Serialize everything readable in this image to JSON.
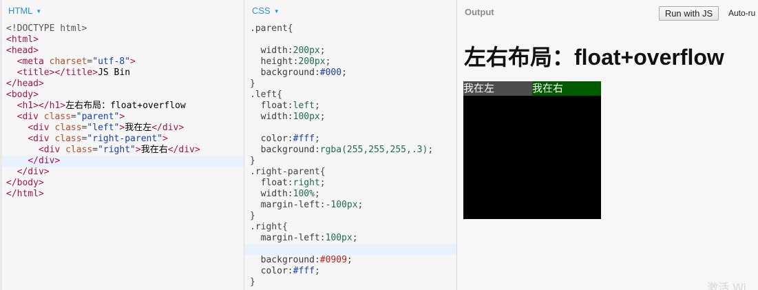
{
  "html_pane": {
    "label": "HTML",
    "code": [
      {
        "doctype": "<!DOCTYPE html>"
      },
      {
        "t1": "<html>"
      },
      {
        "t1": "<head>"
      },
      {
        "ind": "  ",
        "t1": "<meta ",
        "a1": "charset",
        "eq": "=",
        "s1": "\"utf-8\"",
        "t2": ">"
      },
      {
        "ind": "  ",
        "t1": "<title>",
        "x": "JS Bin",
        "t2": "</title>"
      },
      {
        "t1": "</head>"
      },
      {
        "t1": "<body>"
      },
      {
        "ind": "  ",
        "t1": "<h1>",
        "x": "左右布局：float+overflow",
        "t2": "</h1>"
      },
      {
        "ind": "  ",
        "t1": "<div ",
        "a1": "class",
        "eq": "=",
        "s1": "\"parent\"",
        "t2": ">"
      },
      {
        "ind": "    ",
        "t1": "<div ",
        "a1": "class",
        "eq": "=",
        "s1": "\"left\"",
        "t2": ">",
        "x": "我在左",
        "t3": "</div>"
      },
      {
        "ind": "    ",
        "t1": "<div ",
        "a1": "class",
        "eq": "=",
        "s1": "\"right-parent\"",
        "t2": ">"
      },
      {
        "ind": "      ",
        "t1": "<div ",
        "a1": "class",
        "eq": "=",
        "s1": "\"right\"",
        "t2": ">",
        "x": "我在右",
        "t3": "</div>"
      },
      {
        "ind": "    ",
        "t1": "</div>"
      },
      {
        "ind": "  ",
        "t1": "</div>"
      },
      {
        "t1": "</body>"
      },
      {
        "t1": "</html>"
      }
    ]
  },
  "css_pane": {
    "label": "CSS",
    "code": [
      {
        "sel": ".parent{"
      },
      {
        "blank": ""
      },
      {
        "ind": "  ",
        "prop": "width",
        "val": "200px",
        "end": ";"
      },
      {
        "ind": "  ",
        "prop": "height",
        "val": "200px",
        "end": ";"
      },
      {
        "ind": "  ",
        "prop": "background",
        "hex": "#000",
        "end": ";"
      },
      {
        "sel": "}"
      },
      {
        "sel": ".left{"
      },
      {
        "ind": "  ",
        "prop": "float",
        "val": "left",
        "end": ";"
      },
      {
        "ind": "  ",
        "prop": "width",
        "val": "100px",
        "end": ";"
      },
      {
        "blank": ""
      },
      {
        "ind": "  ",
        "prop": "color",
        "hex": "#fff",
        "end": ";"
      },
      {
        "ind": "  ",
        "prop": "background",
        "val": "rgba(255,255,255,.3)",
        "end": ";"
      },
      {
        "sel": "}"
      },
      {
        "sel": ".right-parent{"
      },
      {
        "ind": "  ",
        "prop": "float",
        "val": "right",
        "end": ";"
      },
      {
        "ind": "  ",
        "prop": "width",
        "val": "100%",
        "end": ";"
      },
      {
        "ind": "  ",
        "prop": "margin-left",
        "val": "-100px",
        "end": ";"
      },
      {
        "sel": "}"
      },
      {
        "sel": ".right{"
      },
      {
        "ind": "  ",
        "prop": "margin-left",
        "val": "100px",
        "end": ";"
      },
      {
        "blank": ""
      },
      {
        "ind": "  ",
        "prop": "background",
        "red": "#0909",
        "end": ";"
      },
      {
        "ind": "  ",
        "prop": "color",
        "hex": "#fff",
        "end": ";"
      },
      {
        "sel": "}"
      }
    ]
  },
  "output_pane": {
    "label": "Output",
    "run_button": "Run with JS",
    "autorun_label": "Auto-ru",
    "heading": "左右布局：float+overflow",
    "left_text": "我在左",
    "right_text": "我在右",
    "watermark": "激活 Wi"
  },
  "colors": {
    "accent": "#2b8fd6",
    "parent_bg": "#000000",
    "left_bg": "#4d4d4d",
    "right_bg": "#005a00"
  }
}
